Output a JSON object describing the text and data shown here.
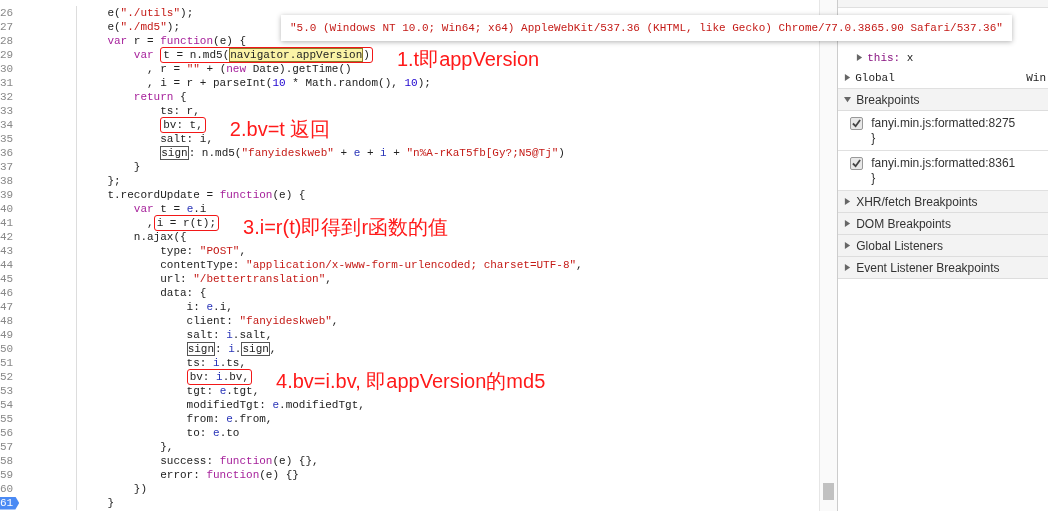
{
  "editor": {
    "lines": [
      {
        "number": "26",
        "breakpoint": false,
        "tokens": [
          {
            "text": "    e(",
            "kind": "plain"
          },
          {
            "text": "\"./utils\"",
            "kind": "string"
          },
          {
            "text": ");",
            "kind": "plain"
          }
        ]
      },
      {
        "number": "27",
        "breakpoint": false,
        "tokens": [
          {
            "text": "    e(",
            "kind": "plain"
          },
          {
            "text": "\"./md5\"",
            "kind": "string"
          },
          {
            "text": ");",
            "kind": "plain"
          }
        ]
      },
      {
        "number": "28",
        "breakpoint": false,
        "tokens": [
          {
            "text": "    var",
            "kind": "keyword"
          },
          {
            "text": " r = ",
            "kind": "plain"
          },
          {
            "text": "function",
            "kind": "keyword"
          },
          {
            "text": "(e) {",
            "kind": "plain"
          }
        ]
      },
      {
        "number": "29",
        "breakpoint": false,
        "note": "1.t即appVersion",
        "tokens": [
          {
            "text": "        var",
            "kind": "keyword"
          },
          {
            "kind": "annotation-box",
            "tokens": [
              {
                "text": " t = n.md5(",
                "kind": "plain"
              },
              {
                "kind": "hover-box",
                "tokens": [
                  {
                    "text": "navigator.appVersion",
                    "kind": "plain"
                  }
                ]
              },
              {
                "text": ")",
                "kind": "plain"
              }
            ]
          }
        ]
      },
      {
        "number": "30",
        "breakpoint": false,
        "tokens": [
          {
            "text": "          , r = ",
            "kind": "plain"
          },
          {
            "text": "\"\"",
            "kind": "string"
          },
          {
            "text": " + (",
            "kind": "plain"
          },
          {
            "text": "new",
            "kind": "keyword"
          },
          {
            "text": " Date).getTime()",
            "kind": "plain"
          }
        ]
      },
      {
        "number": "31",
        "breakpoint": false,
        "tokens": [
          {
            "text": "          , i = r + parseInt(",
            "kind": "plain"
          },
          {
            "text": "10",
            "kind": "number"
          },
          {
            "text": " * Math.random(), ",
            "kind": "plain"
          },
          {
            "text": "10",
            "kind": "number"
          },
          {
            "text": ");",
            "kind": "plain"
          }
        ]
      },
      {
        "number": "32",
        "breakpoint": false,
        "tokens": [
          {
            "text": "        return",
            "kind": "keyword"
          },
          {
            "text": " {",
            "kind": "plain"
          }
        ]
      },
      {
        "number": "33",
        "breakpoint": false,
        "tokens": [
          {
            "text": "            ts: r,",
            "kind": "plain"
          }
        ]
      },
      {
        "number": "34",
        "breakpoint": false,
        "note": "2.bv=t 返回",
        "tokens": [
          {
            "kind": "annotation-box",
            "tokens": [
              {
                "text": "            bv: t,",
                "kind": "plain"
              }
            ]
          }
        ]
      },
      {
        "number": "35",
        "breakpoint": false,
        "tokens": [
          {
            "text": "            salt: i,",
            "kind": "plain"
          }
        ]
      },
      {
        "number": "36",
        "breakpoint": false,
        "tokens": [
          {
            "kind": "match-box",
            "tokens": [
              {
                "text": "            sign",
                "kind": "plain"
              }
            ]
          },
          {
            "text": ": n.md5(",
            "kind": "plain"
          },
          {
            "text": "\"fanyideskweb\"",
            "kind": "string"
          },
          {
            "text": " + ",
            "kind": "plain"
          },
          {
            "text": "e",
            "kind": "variable"
          },
          {
            "text": " + ",
            "kind": "plain"
          },
          {
            "text": "i",
            "kind": "variable"
          },
          {
            "text": " + ",
            "kind": "plain"
          },
          {
            "text": "\"n%A-rKaT5fb[Gy?;N5@Tj\"",
            "kind": "string"
          },
          {
            "text": ")",
            "kind": "plain"
          }
        ]
      },
      {
        "number": "37",
        "breakpoint": false,
        "tokens": [
          {
            "text": "        }",
            "kind": "plain"
          }
        ]
      },
      {
        "number": "38",
        "breakpoint": false,
        "tokens": [
          {
            "text": "    };",
            "kind": "plain"
          }
        ]
      },
      {
        "number": "39",
        "breakpoint": false,
        "tokens": [
          {
            "text": "    t.recordUpdate = ",
            "kind": "plain"
          },
          {
            "text": "function",
            "kind": "keyword"
          },
          {
            "text": "(e) {",
            "kind": "plain"
          }
        ]
      },
      {
        "number": "40",
        "breakpoint": false,
        "tokens": [
          {
            "text": "        var",
            "kind": "keyword"
          },
          {
            "text": " t = ",
            "kind": "plain"
          },
          {
            "text": "e",
            "kind": "variable"
          },
          {
            "text": ".i",
            "kind": "plain"
          }
        ]
      },
      {
        "number": "41",
        "breakpoint": false,
        "note": "3.i=r(t)即得到r函数的值",
        "tokens": [
          {
            "text": "          ,",
            "kind": "plain"
          },
          {
            "kind": "annotation-box",
            "tokens": [
              {
                "text": "i = r(t);",
                "kind": "plain"
              }
            ]
          }
        ]
      },
      {
        "number": "42",
        "breakpoint": false,
        "tokens": [
          {
            "text": "        n.ajax({",
            "kind": "plain"
          }
        ]
      },
      {
        "number": "43",
        "breakpoint": false,
        "tokens": [
          {
            "text": "            type: ",
            "kind": "plain"
          },
          {
            "text": "\"POST\"",
            "kind": "string"
          },
          {
            "text": ",",
            "kind": "plain"
          }
        ]
      },
      {
        "number": "44",
        "breakpoint": false,
        "tokens": [
          {
            "text": "            contentType: ",
            "kind": "plain"
          },
          {
            "text": "\"application/x-www-form-urlencoded; charset=UTF-8\"",
            "kind": "string"
          },
          {
            "text": ",",
            "kind": "plain"
          }
        ]
      },
      {
        "number": "45",
        "breakpoint": false,
        "tokens": [
          {
            "text": "            url: ",
            "kind": "plain"
          },
          {
            "text": "\"/bettertranslation\"",
            "kind": "string"
          },
          {
            "text": ",",
            "kind": "plain"
          }
        ]
      },
      {
        "number": "46",
        "breakpoint": false,
        "tokens": [
          {
            "text": "            data: {",
            "kind": "plain"
          }
        ]
      },
      {
        "number": "47",
        "breakpoint": false,
        "tokens": [
          {
            "text": "                i: ",
            "kind": "plain"
          },
          {
            "text": "e",
            "kind": "variable"
          },
          {
            "text": ".i,",
            "kind": "plain"
          }
        ]
      },
      {
        "number": "48",
        "breakpoint": false,
        "tokens": [
          {
            "text": "                client: ",
            "kind": "plain"
          },
          {
            "text": "\"fanyideskweb\"",
            "kind": "string"
          },
          {
            "text": ",",
            "kind": "plain"
          }
        ]
      },
      {
        "number": "49",
        "breakpoint": false,
        "tokens": [
          {
            "text": "                salt: ",
            "kind": "plain"
          },
          {
            "text": "i",
            "kind": "variable"
          },
          {
            "text": ".salt,",
            "kind": "plain"
          }
        ]
      },
      {
        "number": "50",
        "breakpoint": false,
        "tokens": [
          {
            "kind": "match-box",
            "tokens": [
              {
                "text": "                sign",
                "kind": "plain"
              }
            ]
          },
          {
            "text": ": ",
            "kind": "plain"
          },
          {
            "text": "i",
            "kind": "variable"
          },
          {
            "text": ".",
            "kind": "plain"
          },
          {
            "kind": "match-box",
            "tokens": [
              {
                "text": "sign",
                "kind": "plain"
              }
            ]
          },
          {
            "text": ",",
            "kind": "plain"
          }
        ]
      },
      {
        "number": "51",
        "breakpoint": false,
        "tokens": [
          {
            "text": "                ts: ",
            "kind": "plain"
          },
          {
            "text": "i",
            "kind": "variable"
          },
          {
            "text": ".ts,",
            "kind": "plain"
          }
        ]
      },
      {
        "number": "52",
        "breakpoint": false,
        "note": "4.bv=i.bv, 即appVersion的md5",
        "tokens": [
          {
            "kind": "annotation-box",
            "tokens": [
              {
                "text": "                bv: ",
                "kind": "plain"
              },
              {
                "text": "i",
                "kind": "variable"
              },
              {
                "text": ".bv,",
                "kind": "plain"
              }
            ]
          }
        ]
      },
      {
        "number": "53",
        "breakpoint": false,
        "tokens": [
          {
            "text": "                tgt: ",
            "kind": "plain"
          },
          {
            "text": "e",
            "kind": "variable"
          },
          {
            "text": ".tgt,",
            "kind": "plain"
          }
        ]
      },
      {
        "number": "54",
        "breakpoint": false,
        "tokens": [
          {
            "text": "                modifiedTgt: ",
            "kind": "plain"
          },
          {
            "text": "e",
            "kind": "variable"
          },
          {
            "text": ".modifiedTgt,",
            "kind": "plain"
          }
        ]
      },
      {
        "number": "55",
        "breakpoint": false,
        "tokens": [
          {
            "text": "                from: ",
            "kind": "plain"
          },
          {
            "text": "e",
            "kind": "variable"
          },
          {
            "text": ".from,",
            "kind": "plain"
          }
        ]
      },
      {
        "number": "56",
        "breakpoint": false,
        "tokens": [
          {
            "text": "                to: ",
            "kind": "plain"
          },
          {
            "text": "e",
            "kind": "variable"
          },
          {
            "text": ".to",
            "kind": "plain"
          }
        ]
      },
      {
        "number": "57",
        "breakpoint": false,
        "tokens": [
          {
            "text": "            },",
            "kind": "plain"
          }
        ]
      },
      {
        "number": "58",
        "breakpoint": false,
        "tokens": [
          {
            "text": "            success: ",
            "kind": "plain"
          },
          {
            "text": "function",
            "kind": "keyword"
          },
          {
            "text": "(e) {},",
            "kind": "plain"
          }
        ]
      },
      {
        "number": "59",
        "breakpoint": false,
        "tokens": [
          {
            "text": "            error: ",
            "kind": "plain"
          },
          {
            "text": "function",
            "kind": "keyword"
          },
          {
            "text": "(e) {}",
            "kind": "plain"
          }
        ]
      },
      {
        "number": "60",
        "breakpoint": false,
        "tokens": [
          {
            "text": "        })",
            "kind": "plain"
          }
        ]
      },
      {
        "number": "61",
        "breakpoint": true,
        "tokens": [
          {
            "text": "    }",
            "kind": "plain"
          }
        ]
      }
    ],
    "tooltip": "\"5.0 (Windows NT 10.0; Win64; x64) AppleWebKit/537.36 (KHTML, like Gecko) Chrome/77.0.3865.90 Safari/537.36\""
  },
  "sidebar": {
    "scope": [
      {
        "kind": "property",
        "name": "this:",
        "value": "x",
        "expanded": false
      },
      {
        "kind": "scope",
        "name": "Global",
        "value": "Win",
        "expanded": false
      }
    ],
    "sections": [
      {
        "title": "Breakpoints",
        "expanded": true,
        "items": [
          {
            "label": "fanyi.min.js:formatted:8275",
            "code": "}",
            "checked": true
          },
          {
            "label": "fanyi.min.js:formatted:8361",
            "code": "}",
            "checked": true
          }
        ]
      },
      {
        "title": "XHR/fetch Breakpoints",
        "expanded": false
      },
      {
        "title": "DOM Breakpoints",
        "expanded": false
      },
      {
        "title": "Global Listeners",
        "expanded": false
      },
      {
        "title": "Event Listener Breakpoints",
        "expanded": false
      }
    ]
  }
}
